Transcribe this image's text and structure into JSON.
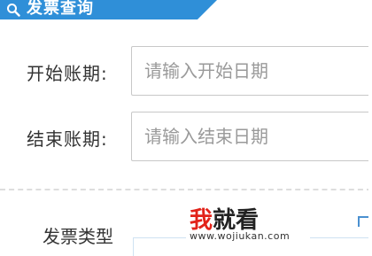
{
  "header": {
    "title": "发票查询",
    "icon": "search-icon",
    "color": "#2f8fd8"
  },
  "form": {
    "start_label": "开始账期:",
    "start_placeholder": "请输入开始日期",
    "end_label": "结束账期:",
    "end_placeholder": "请输入结束日期",
    "type_label": "发票类型"
  },
  "watermark": {
    "main_red": "我",
    "main_rest": "就看",
    "url": "www.wojiukan.com"
  }
}
